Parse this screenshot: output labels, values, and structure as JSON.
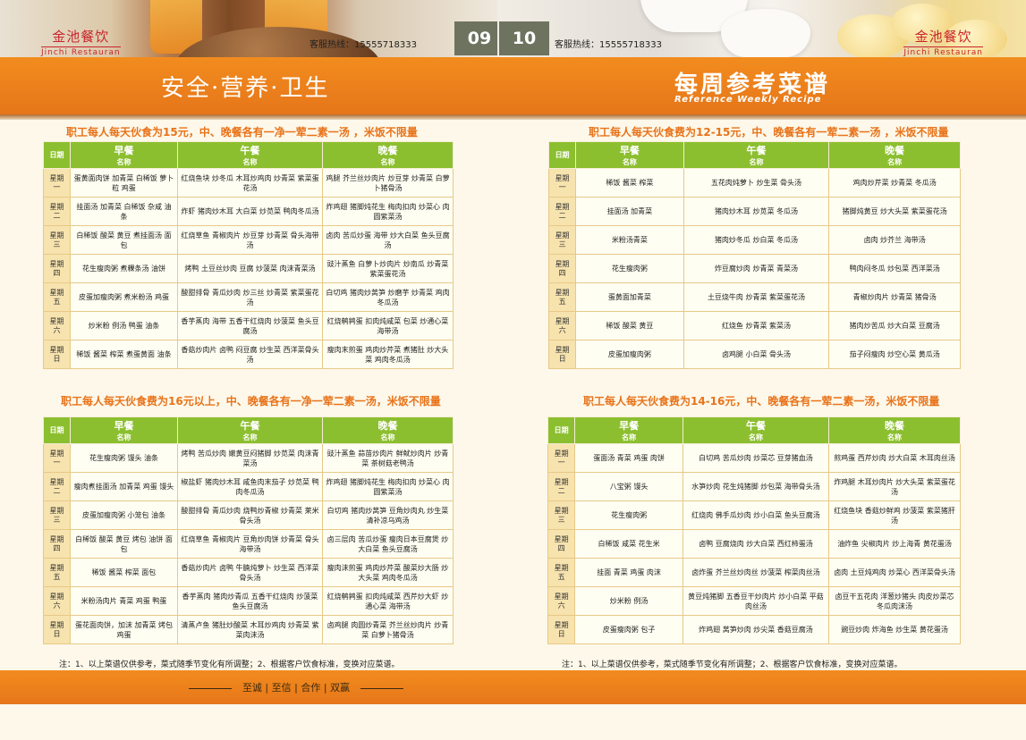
{
  "left": {
    "brand_cn": "金池餐饮",
    "brand_en": "Jinchi Restauran",
    "hotline": "客服热线：15555718333",
    "page_number": "09",
    "banner_title": "安全·营养·卫生",
    "note": "注：1、以上菜谱仅供参考，菜式随季节变化有所调整；2、根据客户饮食标准，变换对应菜谱。",
    "motto": "至诚 | 至信 | 合作 | 双赢",
    "tables": [
      {
        "heading": "职工每人每天伙食为15元，中、晚餐各有一净一荤二素一汤 ，米饭不限量",
        "headers": {
          "day": "日期",
          "breakfast": "早餐",
          "lunch": "午餐",
          "dinner": "晚餐",
          "sub": "名称"
        },
        "rows": [
          {
            "day": "星期一",
            "breakfast": "蛋黄面肉饼 加青菜 白稀饭 萝卜粒 鸡蛋",
            "lunch": "红烧鱼块 炒冬瓜 木耳炒鸡肉 炒青菜 紫菜蛋花汤",
            "dinner": "鸡腿 芥兰丝炒肉片 炒豆芽 炒青菜 白萝卜猪骨汤"
          },
          {
            "day": "星期二",
            "breakfast": "挂面汤 加青菜 白稀饭 杂咸 油条",
            "lunch": "炸虾 猪肉炒木耳 大白菜 炒苋菜 鸭肉冬瓜汤",
            "dinner": "炸鸡翅 猪脚炖花生 梅肉扣肉 炒菜心 肉圆紫菜汤"
          },
          {
            "day": "星期三",
            "breakfast": "白稀饭 酸菜 黄豆 煮挂面汤 面包",
            "lunch": "红烧草鱼 青椒肉片 炒豆芽 炒青菜 骨头海带汤",
            "dinner": "卤肉 苦瓜炒蛋 海带 炒大白菜 鱼头豆腐汤"
          },
          {
            "day": "星期四",
            "breakfast": "花生瘦肉粥 煮粿条汤 油饼",
            "lunch": "烤鸭 土豆丝炒肉 豆腐 炒菠菜 肉沫青菜汤",
            "dinner": "豉汁蒸鱼 白萝卜炒肉片 炒南瓜 炒青菜 紫菜蛋花汤"
          },
          {
            "day": "星期五",
            "breakfast": "皮蛋加瘦肉粥 煮米粉汤 鸡蛋",
            "lunch": "酸甜排骨 青瓜炒肉 炒三丝 炒青菜 紫菜蛋花汤",
            "dinner": "白切鸡 猪肉炒莴笋 炒磨芋 炒青菜 鸡肉冬瓜汤"
          },
          {
            "day": "星期六",
            "breakfast": "炒米粉 例汤 鸭蛋 油条",
            "lunch": "香芋蒸肉 海带 五香干红烧肉 炒菠菜 鱼头豆腐汤",
            "dinner": "红烧鹌鹑蛋 扣肉炖咸菜 包菜 炒通心菜 海带汤"
          },
          {
            "day": "星期日",
            "breakfast": "稀饭 酱菜 榨菜 煮蛋黄面 油条",
            "lunch": "香菇炒肉片 卤鸭 闷豆腐 炒生菜 西洋菜骨头汤",
            "dinner": "瘦肉末煎蛋 鸡肉炒芹菜 煮猪肚 炒大头菜 鸡肉冬瓜汤"
          }
        ]
      },
      {
        "heading": "职工每人每天伙食费为16元以上，中、晚餐各有一净一荤二素一汤，米饭不限量",
        "headers": {
          "day": "日期",
          "breakfast": "早餐",
          "lunch": "午餐",
          "dinner": "晚餐",
          "sub": "名称"
        },
        "rows": [
          {
            "day": "星期一",
            "breakfast": "花生瘦肉粥 馒头 油条",
            "lunch": "烤鸭 苦瓜炒肉 嫩黄豆闷猪脚 炒苋菜 肉沫青菜汤",
            "dinner": "豉汁蒸鱼 蒜苗炒肉片 鲜鱿炒肉片 炒青菜 茶树菇老鸭汤"
          },
          {
            "day": "星期二",
            "breakfast": "瘦肉煮挂面汤 加青菜 鸡蛋 馒头",
            "lunch": "椒盐虾 猪肉炒木耳 咸鱼肉末茄子 炒苋菜 鸭肉冬瓜汤",
            "dinner": "炸鸡翅 猪脚炖花生 梅肉扣肉 炒菜心 肉圆紫菜汤"
          },
          {
            "day": "星期三",
            "breakfast": "皮蛋加瘦肉粥 小笼包 油条",
            "lunch": "酸甜排骨 青瓜炒肉 烧鸭炒青椒 炒青菜 莱米骨头汤",
            "dinner": "白切鸡 猪肉炒莴笋 豆角炒肉丸 炒生菜 清补凉乌鸡汤"
          },
          {
            "day": "星期四",
            "breakfast": "白稀饭 酸菜 黄豆 烤包 油饼 面包",
            "lunch": "红烧草鱼 青椒肉片 豆角炒肉饼 炒青菜 骨头海带汤",
            "dinner": "卤三层肉 苦瓜炒蛋 瘦肉日本豆腐煲 炒大白菜 鱼头豆腐汤"
          },
          {
            "day": "星期五",
            "breakfast": "稀饭 酱菜 榨菜 面包",
            "lunch": "香菇炒肉片 卤鸭 牛腩炖萝卜 炒生菜 西洋菜骨头汤",
            "dinner": "瘦肉沫煎蛋 鸡肉炒芹菜 酸菜炒大肠 炒大头菜 鸡肉冬瓜汤"
          },
          {
            "day": "星期六",
            "breakfast": "米粉汤肉片 青菜 鸡蛋 鸭蛋",
            "lunch": "香芋蒸肉 猪肉炒青瓜 五香干红烧肉 炒菠菜 鱼头豆腐汤",
            "dinner": "红烧鹌鹑蛋 扣肉炖咸菜 西芹炒大虾 炒通心菜 海带汤"
          },
          {
            "day": "星期日",
            "breakfast": "蛋花面肉饼，加沫 加青菜 烤包 鸡蛋",
            "lunch": "清蒸卢鱼 猪肚炒酸菜 木耳炒鸡肉 炒青菜 紫菜肉沫汤",
            "dinner": "卤鸡腿 肉圆炒青菜 芥兰丝炒肉片 炒青菜 白萝卜猪骨汤"
          }
        ]
      }
    ]
  },
  "right": {
    "brand_cn": "金池餐饮",
    "brand_en": "Jinchi Restauran",
    "hotline": "客服热线：15555718333",
    "page_number": "10",
    "banner_title": "每周参考菜谱",
    "banner_subtitle": "Reference Weekly Recipe",
    "note": "注：1、以上菜谱仅供参考，菜式随季节变化有所调整；2、根据客户饮食标准，变换对应菜谱。",
    "tables": [
      {
        "heading": "职工每人每天伙食费为12-15元，中、晚餐各有一荤二素一汤 ，米饭不限量",
        "headers": {
          "day": "日期",
          "breakfast": "早餐",
          "lunch": "午餐",
          "dinner": "晚餐",
          "sub": "名称"
        },
        "rows": [
          {
            "day": "星期一",
            "breakfast": "稀饭 酱菜 榨菜",
            "lunch": "五花肉炖萝卜 炒生菜 骨头汤",
            "dinner": "鸡肉炒芹菜 炒青菜 冬瓜汤"
          },
          {
            "day": "星期二",
            "breakfast": "挂面汤 加青菜",
            "lunch": "猪肉炒木耳 炒苋菜 冬瓜汤",
            "dinner": "猪脚炖黄豆 炒大头菜 紫菜蛋花汤"
          },
          {
            "day": "星期三",
            "breakfast": "米粉汤青菜",
            "lunch": "猪肉炒冬瓜 炒白菜 冬瓜汤",
            "dinner": "卤肉 炒芥兰 海带汤"
          },
          {
            "day": "星期四",
            "breakfast": "花生瘦肉粥",
            "lunch": "炸豆腐炒肉 炒青菜 青菜汤",
            "dinner": "鸭肉闷冬瓜 炒包菜 西洋菜汤"
          },
          {
            "day": "星期五",
            "breakfast": "蛋黄面加青菜",
            "lunch": "土豆烧牛肉 炒青菜 紫菜蛋花汤",
            "dinner": "青椒炒肉片 炒青菜 猪骨汤"
          },
          {
            "day": "星期六",
            "breakfast": "稀饭 酸菜 黄豆",
            "lunch": "红烧鱼 炒青菜 紫菜汤",
            "dinner": "猪肉炒苦瓜 炒大白菜 豆腐汤"
          },
          {
            "day": "星期日",
            "breakfast": "皮蛋加瘦肉粥",
            "lunch": "卤鸡腿 小白菜 骨头汤",
            "dinner": "茄子闷瘦肉 炒空心菜 黄瓜汤"
          }
        ]
      },
      {
        "heading": "职工每人每天伙食费为14-16元，中、晚餐各有一荤二素一汤，米饭不限量",
        "headers": {
          "day": "日期",
          "breakfast": "早餐",
          "lunch": "午餐",
          "dinner": "晚餐",
          "sub": "名称"
        },
        "rows": [
          {
            "day": "星期一",
            "breakfast": "蛋面汤 青菜 鸡蛋 肉饼",
            "lunch": "白切鸡 苦瓜炒肉 炒菜芯 豆芽猪血汤",
            "dinner": "煎鸡蛋 西芹炒肉 炒大白菜 木耳肉丝汤"
          },
          {
            "day": "星期二",
            "breakfast": "八宝粥 馒头",
            "lunch": "水笋炒肉 花生炖猪脚 炒包菜 海带骨头汤",
            "dinner": "炸鸡腿 木耳炒肉片 炒大头菜 紫菜蛋花汤"
          },
          {
            "day": "星期三",
            "breakfast": "花生瘦肉粥",
            "lunch": "红烧肉 佛手瓜炒肉 炒小白菜 鱼头豆腐汤",
            "dinner": "红烧鱼块 香菇炒鲜鸡 炒菠菜 紫菜猪肝汤"
          },
          {
            "day": "星期四",
            "breakfast": "白稀饭 咸菜 花生米",
            "lunch": "卤鸭 豆腐烧肉 炒大白菜 西红柿蛋汤",
            "dinner": "油炸鱼 尖椒肉片 炒上海青 黄花蛋汤"
          },
          {
            "day": "星期五",
            "breakfast": "挂面 青菜 鸡蛋 肉沫",
            "lunch": "卤炸蛋 芥兰丝炒肉丝 炒菠菜 榨菜肉丝汤",
            "dinner": "卤肉 土豆炖鸡肉 炒菜心 西洋菜骨头汤"
          },
          {
            "day": "星期六",
            "breakfast": "炒米粉 例汤",
            "lunch": "黄豆炖猪脚 五香豆干炒肉片 炒小白菜 平菇肉丝汤",
            "dinner": "卤豆干五花肉 洋葱炒猪头 肉皮炒菜芯 冬瓜肉沫汤"
          },
          {
            "day": "星期日",
            "breakfast": "皮蛋瘦肉粥 包子",
            "lunch": "炸鸡翅 莴笋炒肉 炒尖菜 香菇豆腐汤",
            "dinner": "豌豆炒肉 炸海鱼 炒生菜 黄花蛋汤"
          }
        ]
      }
    ]
  },
  "colors": {
    "orange": "#e6761a",
    "heading_orange": "#e8731a",
    "header_green": "#8cbf2f",
    "brand_red": "#c8252c",
    "page_gray": "#6e7360"
  }
}
